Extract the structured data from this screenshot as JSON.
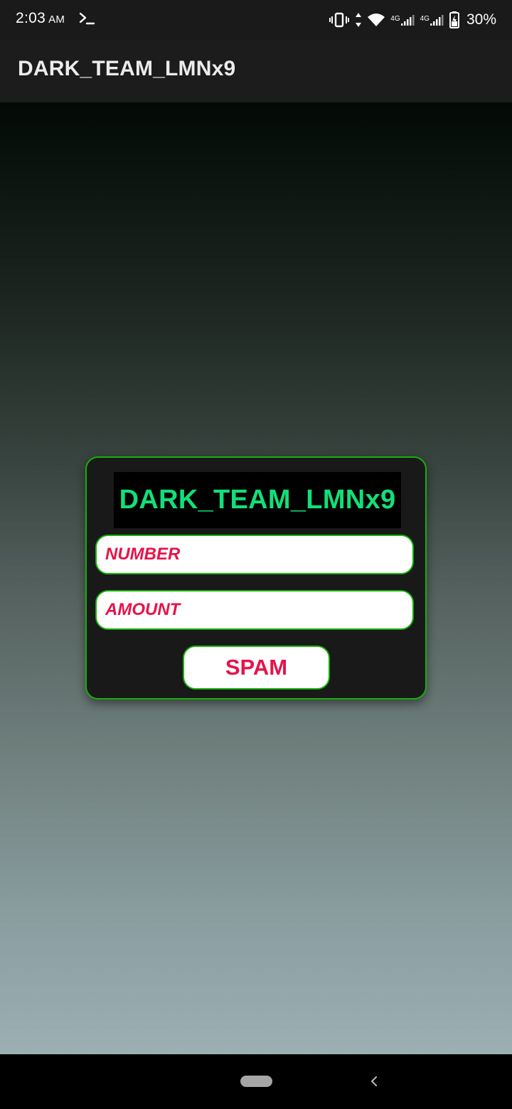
{
  "status_bar": {
    "time": "2:03",
    "ampm": "AM",
    "battery": "30%",
    "icons": [
      "terminal-icon",
      "vibrate-icon",
      "data-arrows-icon",
      "wifi-icon",
      "signal-4g-icon",
      "signal-4g-icon",
      "battery-charging-icon"
    ],
    "network_label_1": "4G",
    "network_label_2": "4G"
  },
  "app_bar": {
    "title": "DARK_TEAM_LMNx9"
  },
  "card": {
    "title": "DARK_TEAM_LMNx9",
    "number_placeholder": "NUMBER",
    "amount_placeholder": "AMOUNT",
    "spam_label": "SPAM"
  },
  "nav_bar": {
    "icons": [
      "home-pill-icon",
      "back-chevron-icon"
    ]
  },
  "colors": {
    "accent_green": "#18b00c",
    "title_green": "#12df78",
    "input_text": "#e5144a"
  }
}
